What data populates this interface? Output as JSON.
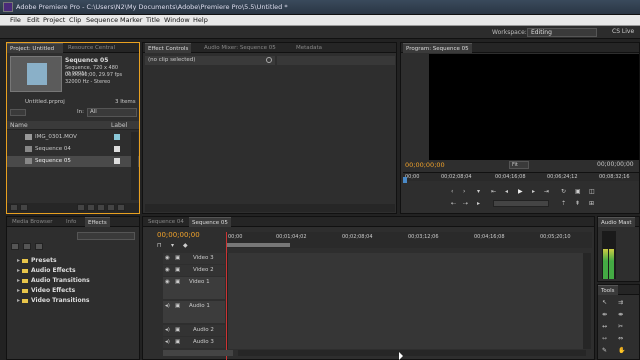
{
  "window": {
    "title": "Adobe Premiere Pro - C:\\Users\\N2\\My Documents\\Adobe\\Premiere Pro\\5.5\\Untitled *"
  },
  "menu": [
    "File",
    "Edit",
    "Project",
    "Clip",
    "Sequence",
    "Marker",
    "Title",
    "Window",
    "Help"
  ],
  "workspace": {
    "label": "Workspace:",
    "value": "Editing",
    "cs_live": "CS Live"
  },
  "project_panel": {
    "tabs": [
      "Project: Untitled",
      "Resource Central"
    ],
    "seq_name": "Sequence 05",
    "seq_info1": "Sequence, 720 x 480 (0.9091)",
    "seq_info2": "00;00;00;00, 29.97 fps",
    "seq_info3": "32000 Hz - Stereo",
    "project_file": "Untitled.prproj",
    "items_count": "3 Items",
    "in_label": "In:",
    "in_value": "All",
    "col_name": "Name",
    "col_label": "Label",
    "items": [
      "IMG_0301.MOV",
      "Sequence 04",
      "Sequence 05"
    ]
  },
  "effect_controls": {
    "tabs": [
      "Effect Controls",
      "Audio Mixer: Sequence 05",
      "Metadata"
    ],
    "no_clip": "(no clip selected)"
  },
  "program_monitor": {
    "tab": "Program: Sequence 05",
    "timecode_left": "00;00;00;00",
    "fit": "Fit",
    "timecode_right": "00;00;00;00",
    "ruler": [
      "00;00",
      "00;02;08;04",
      "00;04;16;08",
      "00;06;24;12",
      "00;08;32;16"
    ]
  },
  "effects_panel": {
    "tabs": [
      "Media Browser",
      "Info",
      "Effects"
    ],
    "items": [
      "Presets",
      "Audio Effects",
      "Audio Transitions",
      "Video Effects",
      "Video Transitions"
    ]
  },
  "timeline": {
    "tabs": [
      "Sequence 04",
      "Sequence 05"
    ],
    "timecode": "00;00;00;00",
    "ruler": [
      "00;00",
      "00;01;04;02",
      "00;02;08;04",
      "00;03;12;06",
      "00;04;16;08",
      "00;05;20;10"
    ],
    "tracks": [
      "Video 3",
      "Video 2",
      "Video 1",
      "Audio 1",
      "Audio 2",
      "Audio 3"
    ]
  },
  "audio_master": {
    "tab": "Audio Mast"
  },
  "tools": {
    "tab": "Tools"
  }
}
